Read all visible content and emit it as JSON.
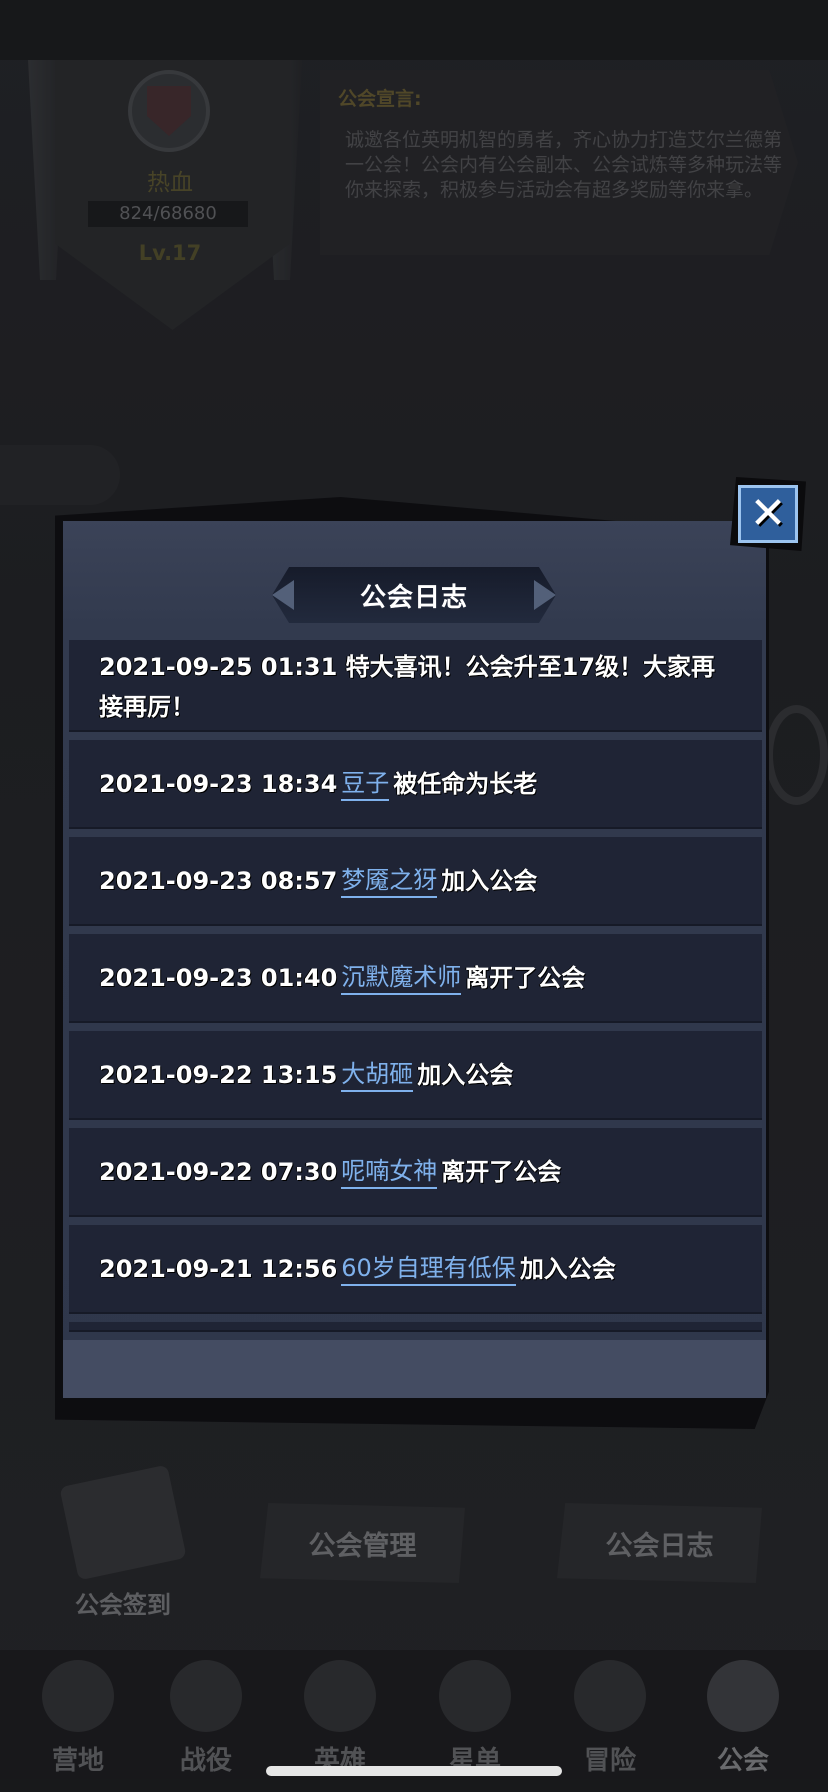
{
  "guild": {
    "name": "热血",
    "exp": "824/68680",
    "level": "Lv.17",
    "declaration_title": "公会宣言:",
    "declaration_text": "诚邀各位英明机智的勇者，齐心协力打造艾尔兰德第一公会！公会内有公会副本、公会试炼等多种玩法等你来探索，积极参与活动会有超多奖励等你来拿。"
  },
  "actions": {
    "sign_in": "公会签到",
    "manage": "公会管理",
    "log": "公会日志"
  },
  "nav": [
    {
      "label": "营地",
      "icon": "camp-icon"
    },
    {
      "label": "战役",
      "icon": "battle-icon"
    },
    {
      "label": "英雄",
      "icon": "hero-icon"
    },
    {
      "label": "星单",
      "icon": "star-icon"
    },
    {
      "label": "冒险",
      "icon": "adventure-icon"
    },
    {
      "label": "公会",
      "icon": "guild-icon"
    }
  ],
  "modal": {
    "title": "公会日志",
    "close_icon": "close-icon",
    "entries": [
      {
        "time": "2021-09-25 01:31",
        "text": "特大喜讯！公会升至17级！大家再接再厉！"
      },
      {
        "time": "2021-09-23 18:34",
        "name": "豆子",
        "action": "被任命为长老"
      },
      {
        "time": "2021-09-23 08:57",
        "name": "梦魇之犽",
        "action": "加入公会"
      },
      {
        "time": "2021-09-23 01:40",
        "name": "沉默魔术师",
        "action": "离开了公会"
      },
      {
        "time": "2021-09-22 13:15",
        "name": "大胡砸",
        "action": "加入公会"
      },
      {
        "time": "2021-09-22 07:30",
        "name": "呢喃女神",
        "action": "离开了公会"
      },
      {
        "time": "2021-09-21 12:56",
        "name": "60岁自理有低保",
        "action": "加入公会"
      }
    ]
  },
  "colors": {
    "link_name": "#7fb1ec",
    "modal_bg": "#2f374b",
    "row_bg": "#1f2435",
    "close_bg": "#2f5f9c"
  }
}
